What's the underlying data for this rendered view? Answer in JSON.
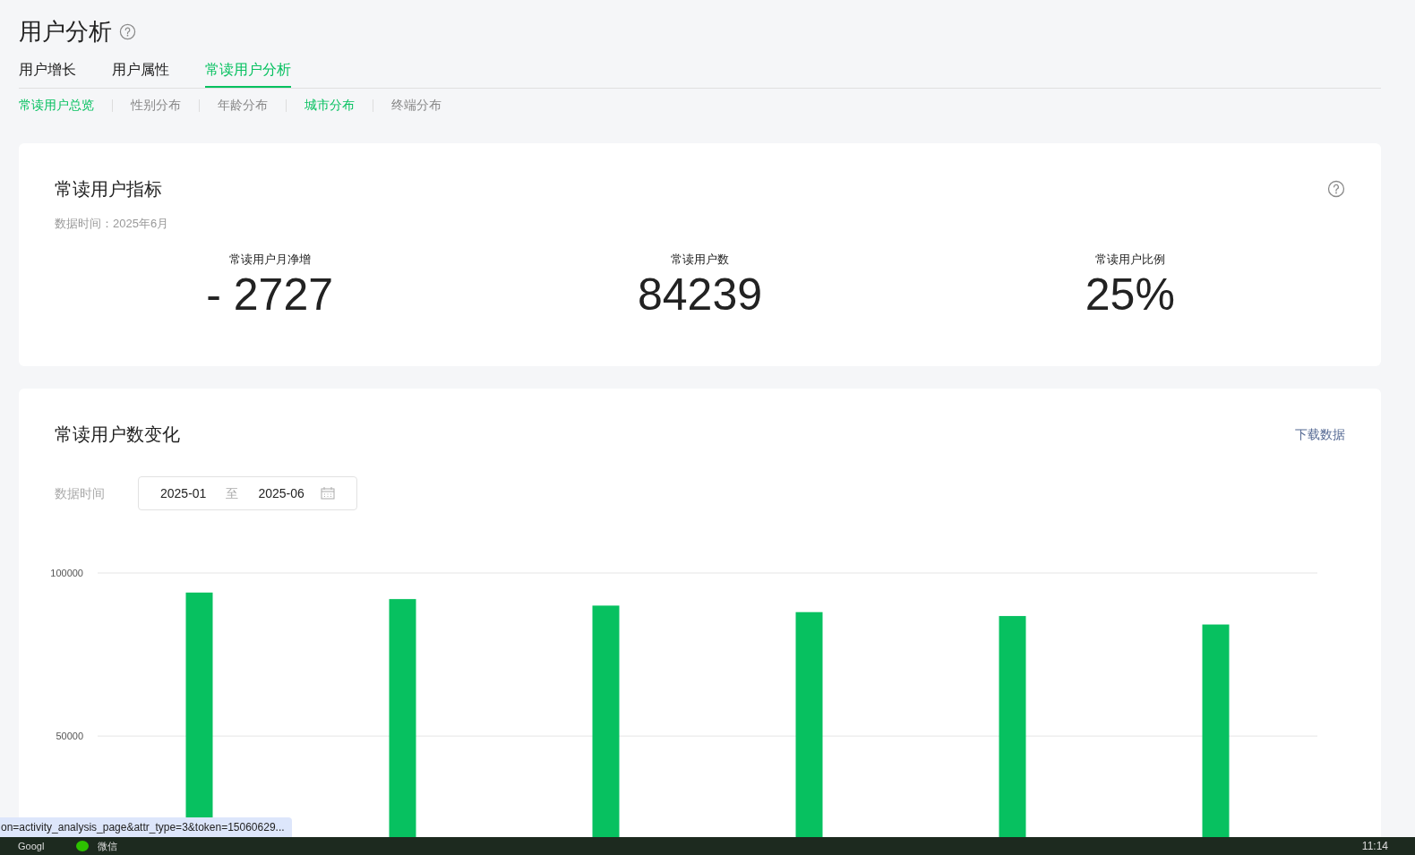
{
  "page": {
    "title": "用户分析"
  },
  "tabs": [
    {
      "label": "用户增长",
      "selected": false
    },
    {
      "label": "用户属性",
      "selected": false
    },
    {
      "label": "常读用户分析",
      "selected": true
    }
  ],
  "subtabs": [
    {
      "label": "常读用户总览",
      "selected": true
    },
    {
      "label": "性别分布",
      "selected": false
    },
    {
      "label": "年龄分布",
      "selected": false
    },
    {
      "label": "城市分布",
      "selected": true
    },
    {
      "label": "终端分布",
      "selected": false
    }
  ],
  "metrics_card": {
    "title": "常读用户指标",
    "data_time": "数据时间：2025年6月",
    "metrics": [
      {
        "label": "常读用户月净增",
        "value": "- 2727"
      },
      {
        "label": "常读用户数",
        "value": "84239"
      },
      {
        "label": "常读用户比例",
        "value": "25%"
      }
    ]
  },
  "trend_card": {
    "title": "常读用户数变化",
    "download": "下载数据",
    "date_label": "数据时间",
    "date_from": "2025-01",
    "date_sep": "至",
    "date_to": "2025-06",
    "chart_data": {
      "type": "bar",
      "ylim": [
        19000,
        100000
      ],
      "yticks": [
        50000,
        100000
      ],
      "series": [
        {
          "color": "#07c160",
          "values": [
            94000,
            92000,
            90000,
            88000,
            86800,
            84200
          ]
        }
      ]
    }
  },
  "status_url": "on=activity_analysis_page&attr_type=3&token=15060629...",
  "taskbar": {
    "items": [
      "Googl",
      "微信"
    ],
    "clock": "11:14"
  }
}
